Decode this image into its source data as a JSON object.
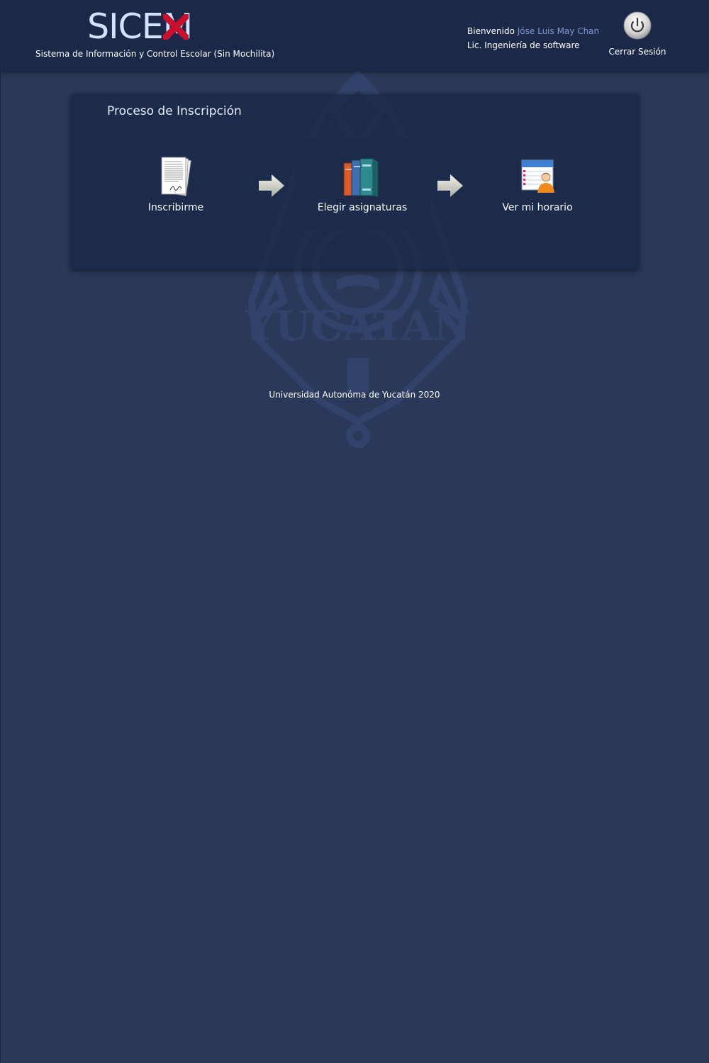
{
  "header": {
    "logo_text": "SICE",
    "logo_last_letter": "M",
    "subtitle": "Sistema de Información y Control Escolar (Sin Mochilita)",
    "welcome_label": "Bienvenido",
    "user_name": "Jóse Luis May Chan",
    "career": "Lic. Ingeniería de software",
    "logout_label": "Cerrar Sesión",
    "logout_icon": "power-icon"
  },
  "panel": {
    "title": "Proceso de Inscripción",
    "steps": [
      {
        "label": "Inscribirme",
        "icon": "signed-documents-icon"
      },
      {
        "label": "Elegir asignaturas",
        "icon": "books-icon"
      },
      {
        "label": "Ver mi horario",
        "icon": "schedule-user-icon"
      }
    ]
  },
  "footer": {
    "text": "Universidad Autonóma de Yucatán 2020"
  },
  "colors": {
    "background": "#2a3859",
    "header": "#1b2848",
    "panel": "#1b2848",
    "card": "#1c2a4b",
    "logo": "#d3e3ff",
    "user_name": "#7f99d8",
    "logo_x": "#c8102e"
  }
}
